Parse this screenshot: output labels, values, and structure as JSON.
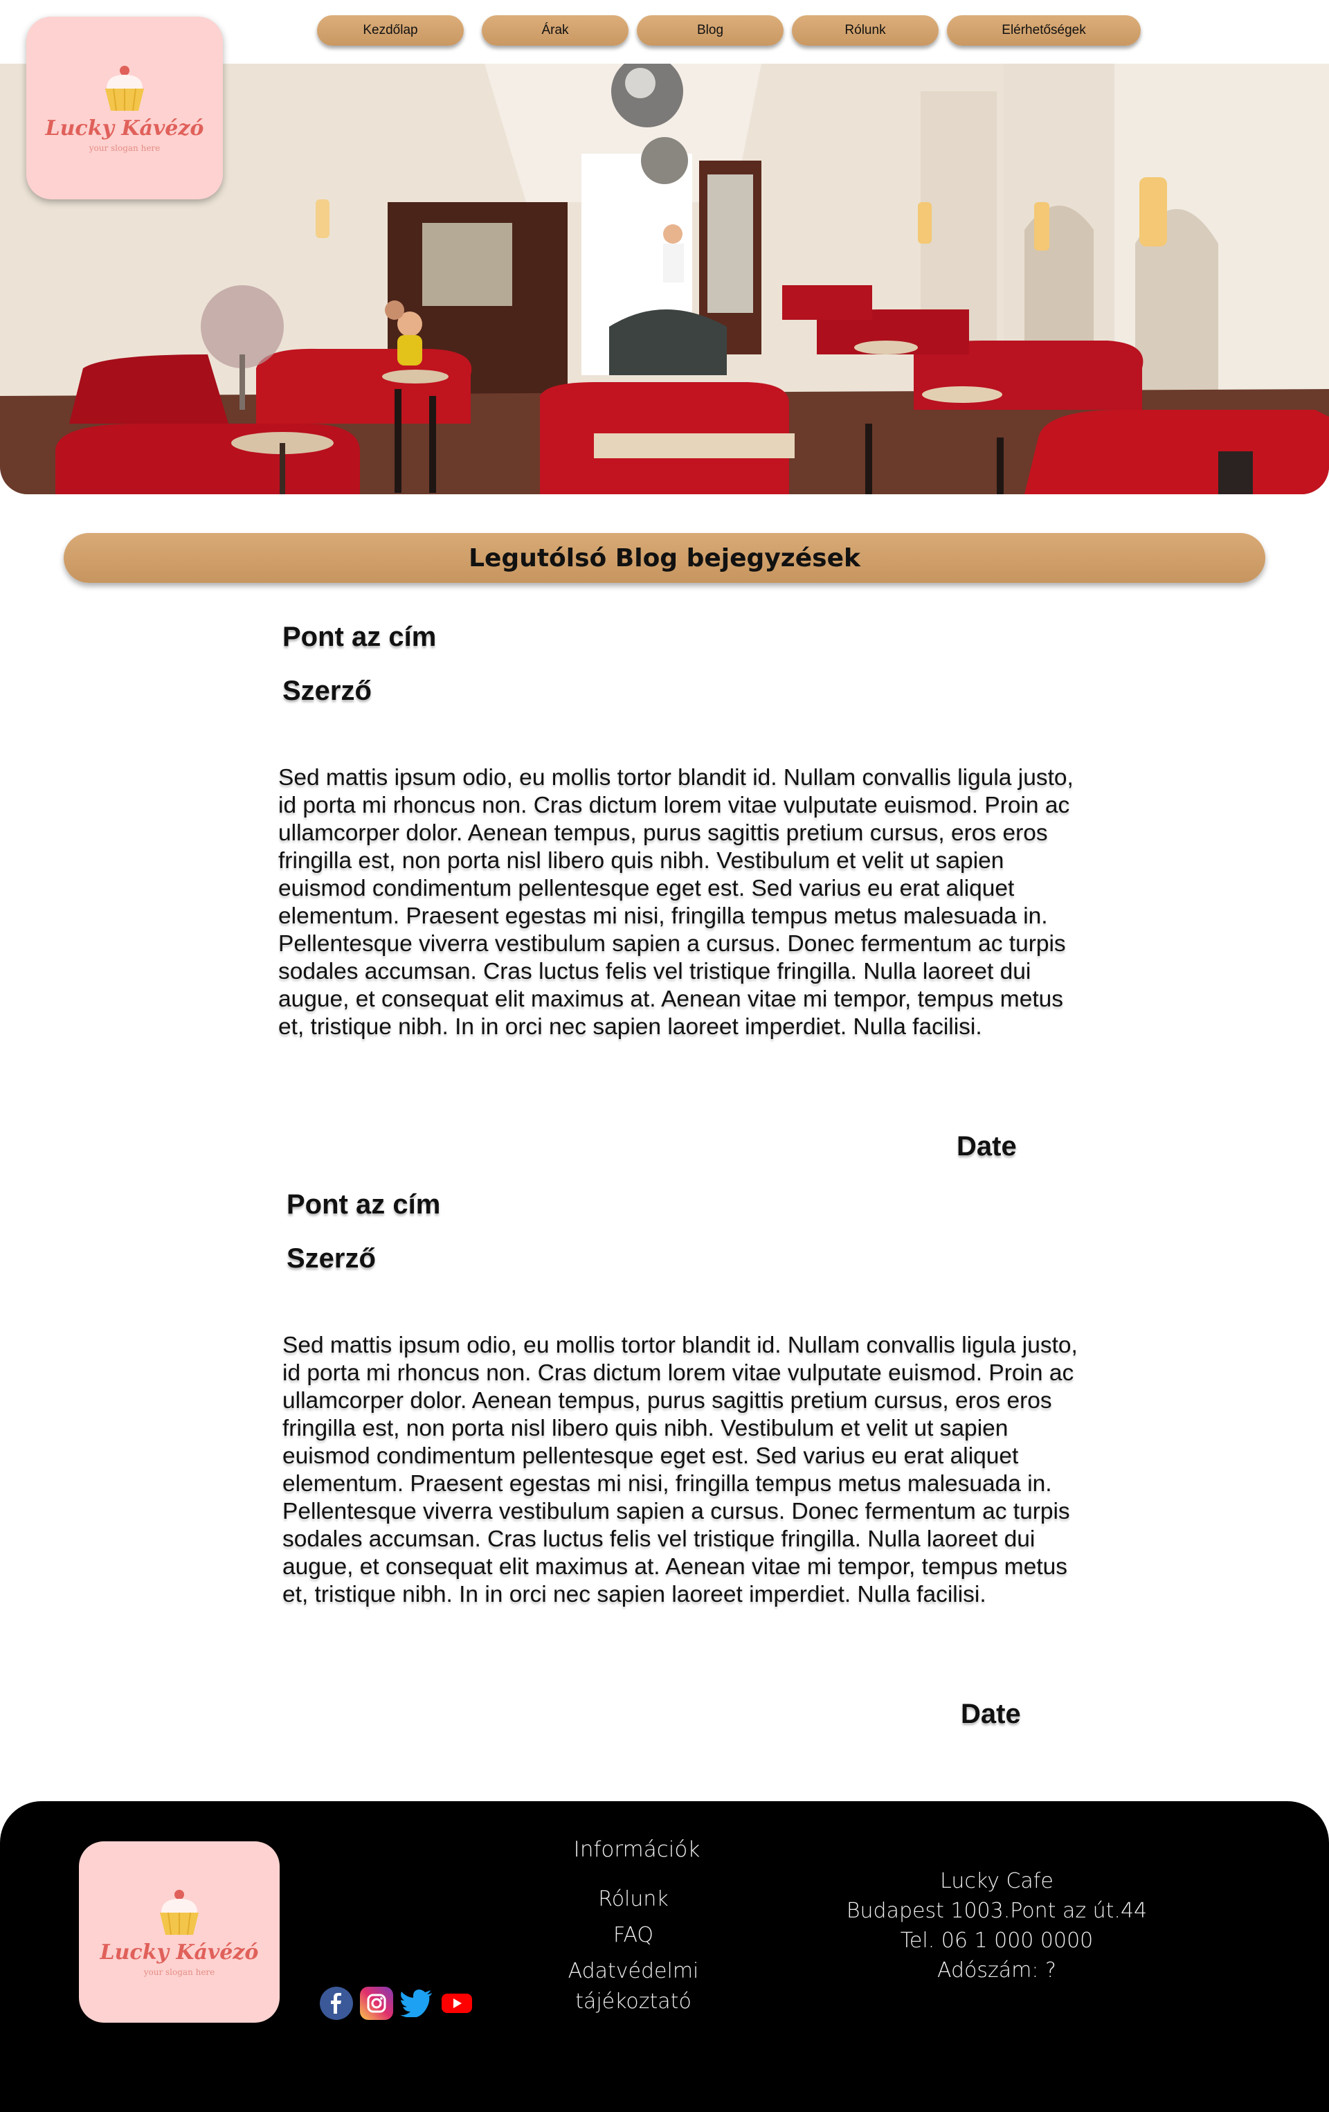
{
  "nav": {
    "items": [
      {
        "label": "Kezdőlap"
      },
      {
        "label": "Árak"
      },
      {
        "label": "Blog"
      },
      {
        "label": "Rólunk"
      },
      {
        "label": "Elérhetőségek"
      }
    ]
  },
  "logo": {
    "name": "Lucky Kávézó",
    "slogan": "your slogan here"
  },
  "section": {
    "title": "Legutólsó Blog bejegyzések"
  },
  "posts": [
    {
      "title": "Pont az cím",
      "author": "Szerző",
      "body": "Sed mattis ipsum odio, eu mollis tortor blandit id. Nullam convallis ligula justo, id porta mi rhoncus non. Cras dictum lorem vitae vulputate euismod. Proin ac ullamcorper dolor. Aenean tempus, purus sagittis pretium cursus, eros eros fringilla est, non porta nisl libero quis nibh. Vestibulum et velit ut sapien euismod condimentum pellentesque eget est. Sed varius eu erat aliquet elementum. Praesent egestas mi nisi, fringilla tempus metus malesuada in. Pellentesque viverra vestibulum sapien a cursus. Donec fermentum ac turpis sodales accumsan. Cras luctus felis vel tristique fringilla. Nulla laoreet dui augue, et consequat elit maximus at. Aenean vitae mi tempor, tempus metus et, tristique nibh. In in orci nec sapien laoreet imperdiet. Nulla facilisi.",
      "date": "Date"
    },
    {
      "title": "Pont az cím",
      "author": "Szerző",
      "body": "Sed mattis ipsum odio, eu mollis tortor blandit id. Nullam convallis ligula justo, id porta mi rhoncus non. Cras dictum lorem vitae vulputate euismod. Proin ac ullamcorper dolor. Aenean tempus, purus sagittis pretium cursus, eros eros fringilla est, non porta nisl libero quis nibh. Vestibulum et velit ut sapien euismod condimentum pellentesque eget est. Sed varius eu erat aliquet elementum. Praesent egestas mi nisi, fringilla tempus metus malesuada in. Pellentesque viverra vestibulum sapien a cursus. Donec fermentum ac turpis sodales accumsan. Cras luctus felis vel tristique fringilla. Nulla laoreet dui augue, et consequat elit maximus at. Aenean vitae mi tempor, tempus metus et, tristique nibh. In in orci nec sapien laoreet imperdiet. Nulla facilisi.",
      "date": "Date"
    }
  ],
  "footer": {
    "info_title": "Információk",
    "links": [
      "Rólunk",
      "FAQ",
      "Adatvédelmi",
      "tájékoztató"
    ],
    "contact": {
      "name": "Lucky Cafe",
      "address": "Budapest 1003.Pont az út.44",
      "phone": "Tel. 06 1 000 0000",
      "tax": "Adószám: ?"
    },
    "social": [
      "facebook-icon",
      "instagram-icon",
      "twitter-icon",
      "youtube-icon"
    ]
  },
  "colors": {
    "accent": "#d4a36e",
    "logo_bg": "#fdd2d0",
    "logo_text": "#e0605a",
    "footer_bg": "#000000"
  }
}
